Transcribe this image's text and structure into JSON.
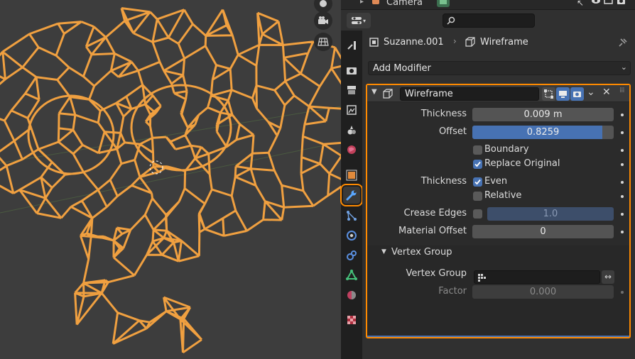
{
  "outliner": {
    "camera_label": "Camera"
  },
  "header": {
    "search_placeholder": ""
  },
  "breadcrumb": {
    "object": "Suzanne.001",
    "modifier": "Wireframe"
  },
  "add_modifier": {
    "label": "Add Modifier"
  },
  "modifier": {
    "name": "Wireframe",
    "thickness": {
      "label": "Thickness",
      "value": "0.009 m"
    },
    "offset": {
      "label": "Offset",
      "value": "0.8259",
      "fraction": 0.92
    },
    "boundary": {
      "label": "Boundary",
      "checked": false
    },
    "replace_original": {
      "label": "Replace Original",
      "checked": true
    },
    "thickness_group": {
      "label": "Thickness",
      "even": {
        "label": "Even",
        "checked": true
      },
      "relative": {
        "label": "Relative",
        "checked": false
      }
    },
    "crease_edges": {
      "label": "Crease Edges",
      "checked": false,
      "value": "1.0"
    },
    "material_offset": {
      "label": "Material Offset",
      "value": "0"
    },
    "vertex_group_panel": {
      "title": "Vertex Group",
      "vertex_group": {
        "label": "Vertex Group",
        "value": ""
      },
      "factor": {
        "label": "Factor",
        "value": "0.000"
      }
    }
  },
  "colors": {
    "accent": "#ff8a00",
    "selection_blue": "#4772b3",
    "wire": "#f0a040"
  },
  "icons": [
    "camera-icon",
    "wrench-icon",
    "render-icon",
    "output-icon",
    "view-layer-icon",
    "scene-icon",
    "world-icon",
    "object-icon",
    "particles-icon",
    "physics-icon",
    "constraints-icon",
    "data-icon",
    "material-icon",
    "texture-icon"
  ]
}
